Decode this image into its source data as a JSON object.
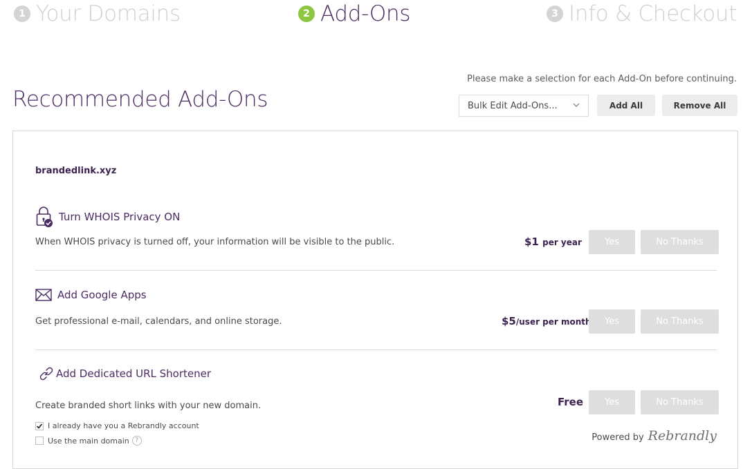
{
  "steps": [
    {
      "number": "1",
      "label": "Your Domains",
      "active": false
    },
    {
      "number": "2",
      "label": "Add-Ons",
      "active": true
    },
    {
      "number": "3",
      "label": "Info & Checkout",
      "active": false
    }
  ],
  "hint": "Please make a selection for each Add-On before continuing.",
  "page_title": "Recommended Add-Ons",
  "toolbar": {
    "bulk_select_value": "Bulk Edit Add-Ons...",
    "add_all": "Add All",
    "remove_all": "Remove All"
  },
  "domain": "brandedlink.xyz",
  "addons": [
    {
      "icon": "lock-check-icon",
      "title": "Turn WHOIS Privacy ON",
      "description": "When WHOIS privacy is turned off, your information will be visible to the public.",
      "price": "$1",
      "price_unit": "per year",
      "yes": "Yes",
      "no": "No Thanks"
    },
    {
      "icon": "envelope-icon",
      "title": "Add Google Apps",
      "description": "Get professional e-mail, calendars, and online storage.",
      "price": "$5",
      "price_unit": "/user per month",
      "yes": "Yes",
      "no": "No Thanks"
    },
    {
      "icon": "link-icon",
      "title": "Add Dedicated URL Shortener",
      "description": "Create branded short links with your new domain.",
      "price": "Free",
      "price_unit": "",
      "yes": "Yes",
      "no": "No Thanks"
    }
  ],
  "shortener_options": {
    "have_account": {
      "label": "I already have you a Rebrandly account",
      "checked": true
    },
    "main_domain": {
      "label": "Use the main domain",
      "checked": false,
      "help": "?"
    }
  },
  "powered_by": "Powered by",
  "brand": "Rebrandly",
  "colors": {
    "brand_purple": "#4a2b63",
    "active_step": "#8dc63f",
    "inactive_step": "#cfcfcf",
    "button_disabled": "#dedede"
  }
}
